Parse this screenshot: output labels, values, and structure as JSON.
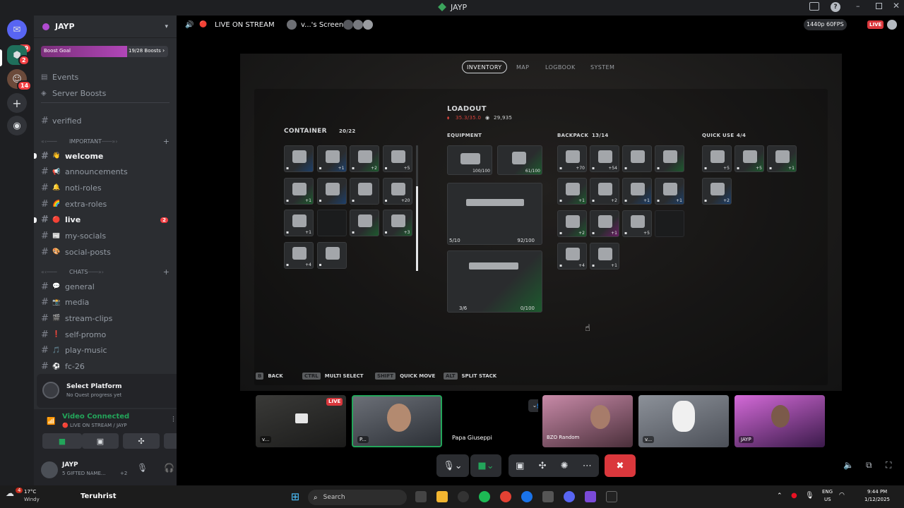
{
  "window": {
    "title": "JAYP"
  },
  "servers": {
    "dm_badge": "29",
    "srv1_badge": "2",
    "srv2_badge": "14"
  },
  "sidebar": {
    "server_name": "JAYP",
    "boost": {
      "label": "Boost Goal",
      "progress": "19/28 Boosts",
      "fraction": 0.68
    },
    "nav": [
      {
        "label": "Events"
      },
      {
        "label": "Server Boosts"
      }
    ],
    "verified": "verified",
    "cat_important": "IMPORTANT",
    "cat_chats": "CHATS",
    "channels_important": [
      {
        "emoji": "👋",
        "label": "welcome",
        "unread": true
      },
      {
        "emoji": "📢",
        "label": "announcements"
      },
      {
        "emoji": "🔔",
        "label": "noti-roles"
      },
      {
        "emoji": "🌈",
        "label": "extra-roles"
      },
      {
        "emoji": "🔴",
        "label": "live",
        "unread": true,
        "badge": "2"
      },
      {
        "emoji": "📰",
        "label": "my-socials"
      },
      {
        "emoji": "🎨",
        "label": "social-posts"
      }
    ],
    "channels_chats": [
      {
        "emoji": "💬",
        "label": "general"
      },
      {
        "emoji": "📸",
        "label": "media"
      },
      {
        "emoji": "🎬",
        "label": "stream-clips"
      },
      {
        "emoji": "❗",
        "label": "self-promo"
      },
      {
        "emoji": "🎵",
        "label": "play-music"
      },
      {
        "emoji": "⚽",
        "label": "fc-26"
      }
    ],
    "platform": {
      "title": "Select Platform",
      "sub": "No Quest progress yet"
    },
    "voice": {
      "status": "Video Connected",
      "channel": "🔴 LIVE ON STREAM / JAYP"
    },
    "user": {
      "name": "JAYP",
      "status": "5 GIFTED NAME...",
      "extra": "+2"
    }
  },
  "topbar": {
    "channel": "LIVE ON STREAM",
    "screen": "v...'s Screen",
    "quality": "1440p 60FPS",
    "live": "LIVE"
  },
  "game": {
    "tabs": [
      "INVENTORY",
      "MAP",
      "LOGBOOK",
      "SYSTEM"
    ],
    "loadout": {
      "title": "LOADOUT",
      "weight": "35.3/35.0",
      "money": "29,935"
    },
    "container": {
      "title": "CONTAINER",
      "count": "20/22",
      "slots": [
        {
          "t": "b",
          "q": ""
        },
        {
          "t": "b",
          "q": "+1"
        },
        {
          "t": "g",
          "q": "+2"
        },
        {
          "t": "",
          "q": "+5"
        },
        {
          "t": "g",
          "q": "+1"
        },
        {
          "t": "b",
          "q": ""
        },
        {
          "t": "",
          "q": ""
        },
        {
          "t": "",
          "q": "+20"
        },
        {
          "t": "",
          "q": "+1"
        },
        {
          "t": "e",
          "q": ""
        },
        {
          "t": "g",
          "q": ""
        },
        {
          "t": "g",
          "q": "+3"
        },
        {
          "t": "",
          "q": "+4"
        },
        {
          "t": "",
          "q": ""
        }
      ]
    },
    "equipment": {
      "title": "EQUIPMENT",
      "armor": "100/100",
      "shield": "61/100",
      "weapon1": {
        "ammo": "5/10",
        "durability": "92/100"
      },
      "weapon2": {
        "ammo": "3/6",
        "durability": "0/100"
      }
    },
    "backpack": {
      "title": "BACKPACK",
      "count": "13/14",
      "slots": [
        {
          "t": "",
          "q": "+70"
        },
        {
          "t": "",
          "q": "+54"
        },
        {
          "t": "",
          "q": ""
        },
        {
          "t": "g",
          "q": ""
        },
        {
          "t": "g",
          "q": "+1"
        },
        {
          "t": "",
          "q": "+2"
        },
        {
          "t": "b",
          "q": "+1"
        },
        {
          "t": "b",
          "q": "+1"
        },
        {
          "t": "g",
          "q": "+2"
        },
        {
          "t": "p",
          "q": "+1"
        },
        {
          "t": "",
          "q": "+5"
        },
        {
          "t": "e",
          "q": ""
        },
        {
          "t": "",
          "q": "+4"
        },
        {
          "t": "",
          "q": "+1"
        }
      ]
    },
    "quickuse": {
      "title": "QUICK USE",
      "count": "4/4",
      "slots": [
        {
          "t": "",
          "q": "+5"
        },
        {
          "t": "g",
          "q": "+5"
        },
        {
          "t": "g",
          "q": "+1"
        },
        {
          "t": "b",
          "q": "+2"
        }
      ]
    },
    "hints": [
      {
        "key": "B",
        "label": "BACK"
      },
      {
        "key": "CTRL",
        "label": "MULTI SELECT"
      },
      {
        "key": "SHIFT",
        "label": "QUICK MOVE"
      },
      {
        "key": "ALT",
        "label": "SPLIT STACK"
      }
    ]
  },
  "participants": [
    {
      "label": "v...",
      "live": "LIVE"
    },
    {
      "label": "P..."
    },
    {
      "label": "Papa Giuseppi"
    },
    {
      "label": "BZO Random"
    },
    {
      "label": "v..."
    },
    {
      "label": "JAYP"
    }
  ],
  "taskbar": {
    "weather_temp": "17°C",
    "weather_desc": "Windy",
    "search": "Search",
    "app_text": "Teruhrist",
    "lang1": "ENG",
    "lang2": "US",
    "time": "9:44 PM",
    "date": "1/12/2025",
    "notif": "4"
  }
}
